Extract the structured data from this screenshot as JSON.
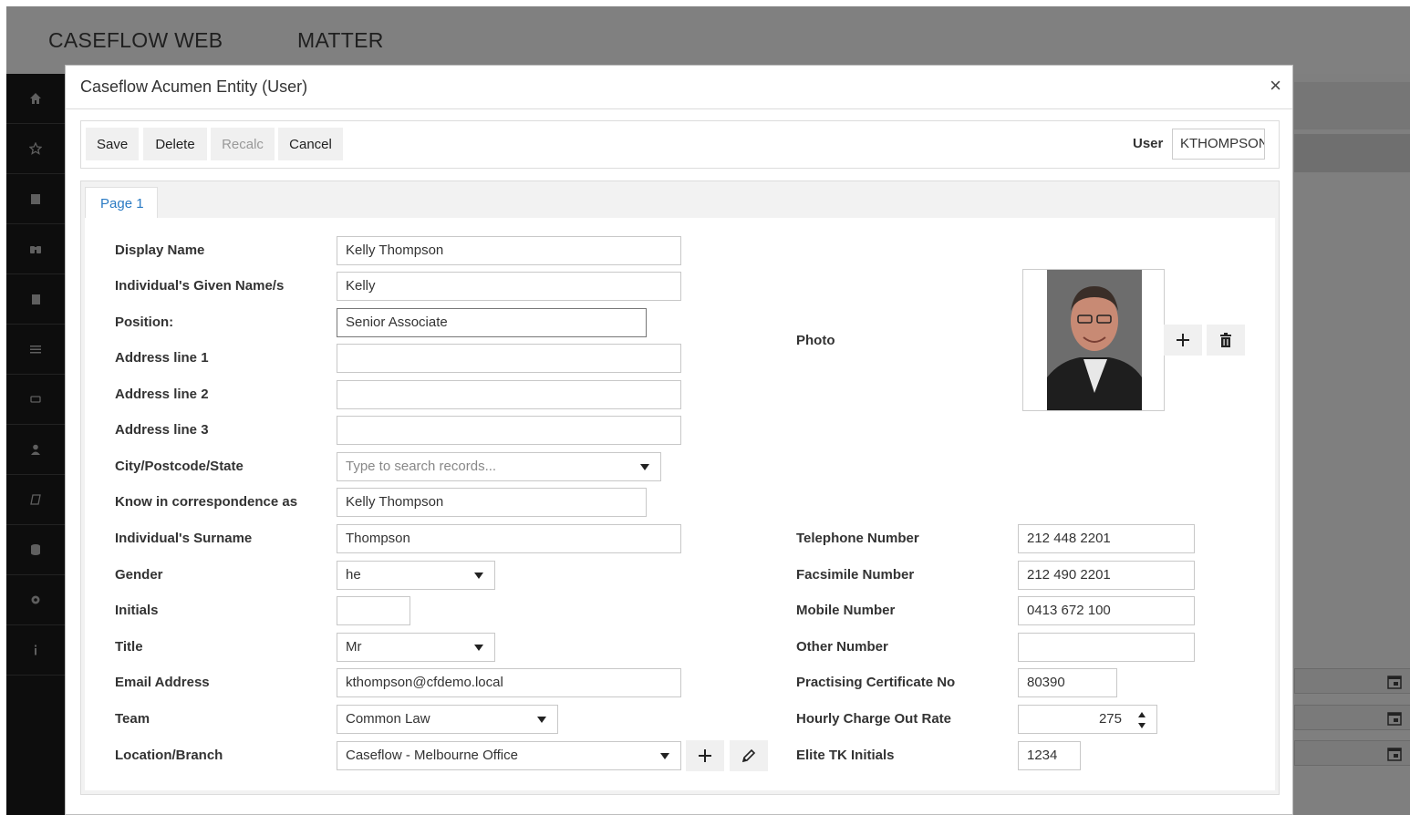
{
  "app": {
    "nav_title": "CASEFLOW WEB",
    "nav_matter": "MATTER",
    "sidebar_icons": [
      "home-icon",
      "star-icon",
      "calendar-icon",
      "binoculars-icon",
      "clipboard-icon",
      "sliders-icon",
      "chat-icon",
      "user-icon",
      "script-icon",
      "database-icon",
      "gear-icon",
      "info-icon"
    ]
  },
  "modal": {
    "title": "Caseflow Acumen Entity (User)",
    "close_glyph": "×",
    "toolbar": {
      "save_label": "Save",
      "delete_label": "Delete",
      "recalc_label": "Recalc",
      "cancel_label": "Cancel",
      "user_label": "User",
      "user_value": "KTHOMPSON"
    },
    "tab_label": "Page 1",
    "left_fields": {
      "display_name": {
        "label": "Display Name",
        "value": "Kelly Thompson"
      },
      "given_names": {
        "label": "Individual's Given Name/s",
        "value": "Kelly"
      },
      "position": {
        "label": "Position:",
        "value": "Senior Associate"
      },
      "address1": {
        "label": "Address line 1",
        "value": ""
      },
      "address2": {
        "label": "Address line 2",
        "value": ""
      },
      "address3": {
        "label": "Address line 3",
        "value": ""
      },
      "city": {
        "label": "City/Postcode/State",
        "placeholder": "Type to search records..."
      },
      "known_as": {
        "label": "Know in correspondence as",
        "value": "Kelly Thompson"
      },
      "surname": {
        "label": "Individual's Surname",
        "value": "Thompson"
      },
      "gender": {
        "label": "Gender",
        "value": "he"
      },
      "initials": {
        "label": "Initials",
        "value": ""
      },
      "title": {
        "label": "Title",
        "value": "Mr"
      },
      "email": {
        "label": "Email Address",
        "value": "kthompson@cfdemo.local"
      },
      "team": {
        "label": "Team",
        "value": "Common Law"
      },
      "location": {
        "label": "Location/Branch",
        "value": "Caseflow - Melbourne Office"
      }
    },
    "right_fields": {
      "photo": {
        "label": "Photo"
      },
      "telephone": {
        "label": "Telephone Number",
        "value": "212 448 2201"
      },
      "facsimile": {
        "label": "Facsimile Number",
        "value": "212 490 2201"
      },
      "mobile": {
        "label": "Mobile Number",
        "value": "0413 672 100"
      },
      "other": {
        "label": "Other Number",
        "value": ""
      },
      "practising_cert": {
        "label": "Practising Certificate No",
        "value": "80390"
      },
      "hourly_rate": {
        "label": "Hourly Charge Out Rate",
        "value": "275"
      },
      "elite_tk": {
        "label": "Elite TK Initials",
        "value": "1234"
      }
    }
  }
}
